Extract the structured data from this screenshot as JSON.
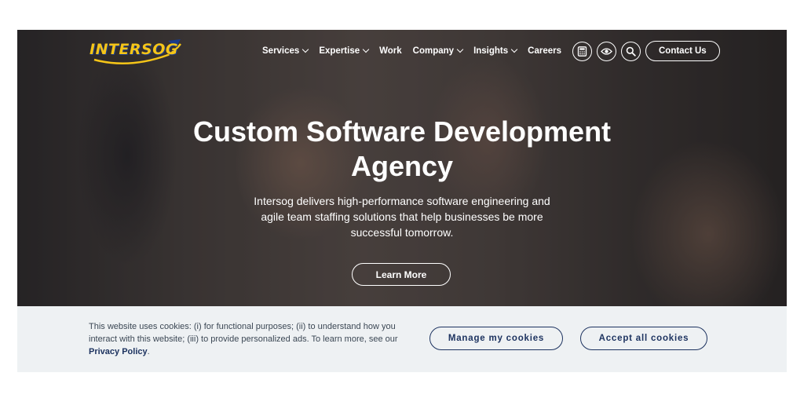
{
  "brand": {
    "logo_text": "INTERSOG",
    "logo_color": "#f5c518"
  },
  "nav": {
    "items": [
      {
        "label": "Services",
        "dropdown": true
      },
      {
        "label": "Expertise",
        "dropdown": true
      },
      {
        "label": "Work",
        "dropdown": false
      },
      {
        "label": "Company",
        "dropdown": true
      },
      {
        "label": "Insights",
        "dropdown": true
      },
      {
        "label": "Careers",
        "dropdown": false
      }
    ],
    "icons": [
      "calculator-icon",
      "eye-icon",
      "search-icon"
    ],
    "contact_label": "Contact Us"
  },
  "hero": {
    "headline_line1": "Custom Software Development",
    "headline_line2": "Agency",
    "subtext": "Intersog delivers high-performance software engineering and agile team staffing solutions that help businesses be more successful tomorrow.",
    "cta_label": "Learn More"
  },
  "cookie": {
    "text": "This website uses cookies: (i) for functional purposes; (ii) to understand how you interact with this website; (iii) to provide personalized ads. To learn more, see our",
    "policy_link": "Privacy Policy",
    "policy_suffix": ".",
    "manage_label": "Manage my cookies",
    "accept_label": "Accept all cookies",
    "accent_color": "#1d3360"
  }
}
